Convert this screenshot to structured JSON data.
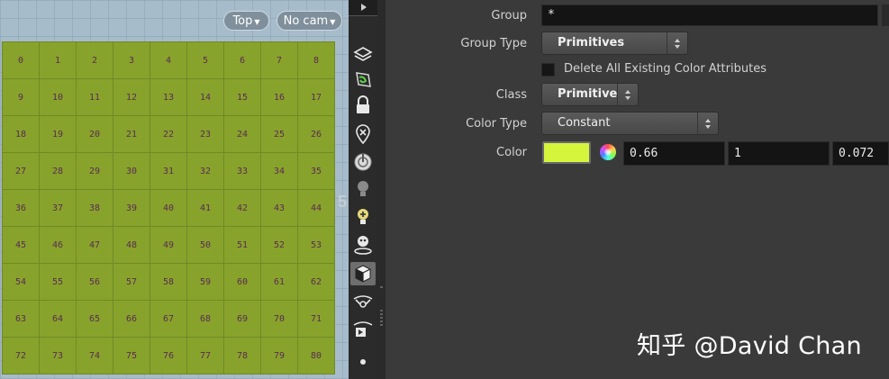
{
  "viewport": {
    "view_menu": "Top",
    "camera_menu": "No cam",
    "cells": [
      "0",
      "1",
      "2",
      "3",
      "4",
      "5",
      "6",
      "7",
      "8",
      "9",
      "10",
      "11",
      "12",
      "13",
      "14",
      "15",
      "16",
      "17",
      "18",
      "19",
      "20",
      "21",
      "22",
      "23",
      "24",
      "25",
      "26",
      "27",
      "28",
      "29",
      "30",
      "31",
      "32",
      "33",
      "34",
      "35",
      "36",
      "37",
      "38",
      "39",
      "40",
      "41",
      "42",
      "43",
      "44",
      "45",
      "46",
      "47",
      "48",
      "49",
      "50",
      "51",
      "52",
      "53",
      "54",
      "55",
      "56",
      "57",
      "58",
      "59",
      "60",
      "61",
      "62",
      "63",
      "64",
      "65",
      "66",
      "67",
      "68",
      "69",
      "70",
      "71",
      "72",
      "73",
      "74",
      "75",
      "76",
      "77",
      "78",
      "79",
      "80"
    ],
    "side_number": "5",
    "grid_color": "#88a32b",
    "label_color": "#5a2a55"
  },
  "toolbar": {
    "icons": [
      "display-layers-icon",
      "snap-icon",
      "lock-icon",
      "ghost-icon",
      "visualizer-icon",
      "light-icon",
      "add-light-icon",
      "headlight-icon",
      "shading-icon",
      "camera-icon",
      "flipbook-icon",
      "dot-icon"
    ],
    "active_icon": "shading-icon"
  },
  "params": {
    "group_label": "Group",
    "group_value": "*",
    "group_type_label": "Group Type",
    "group_type_value": "Primitives",
    "delete_attr_label": "Delete All Existing Color Attributes",
    "delete_attr_checked": false,
    "class_label": "Class",
    "class_value": "Primitive",
    "color_type_label": "Color Type",
    "color_type_value": "Constant",
    "color_label": "Color",
    "color_swatch": "#d4f53c",
    "color_r": "0.66",
    "color_g": "1",
    "color_b": "0.072"
  },
  "watermark": "知乎 @David Chan"
}
